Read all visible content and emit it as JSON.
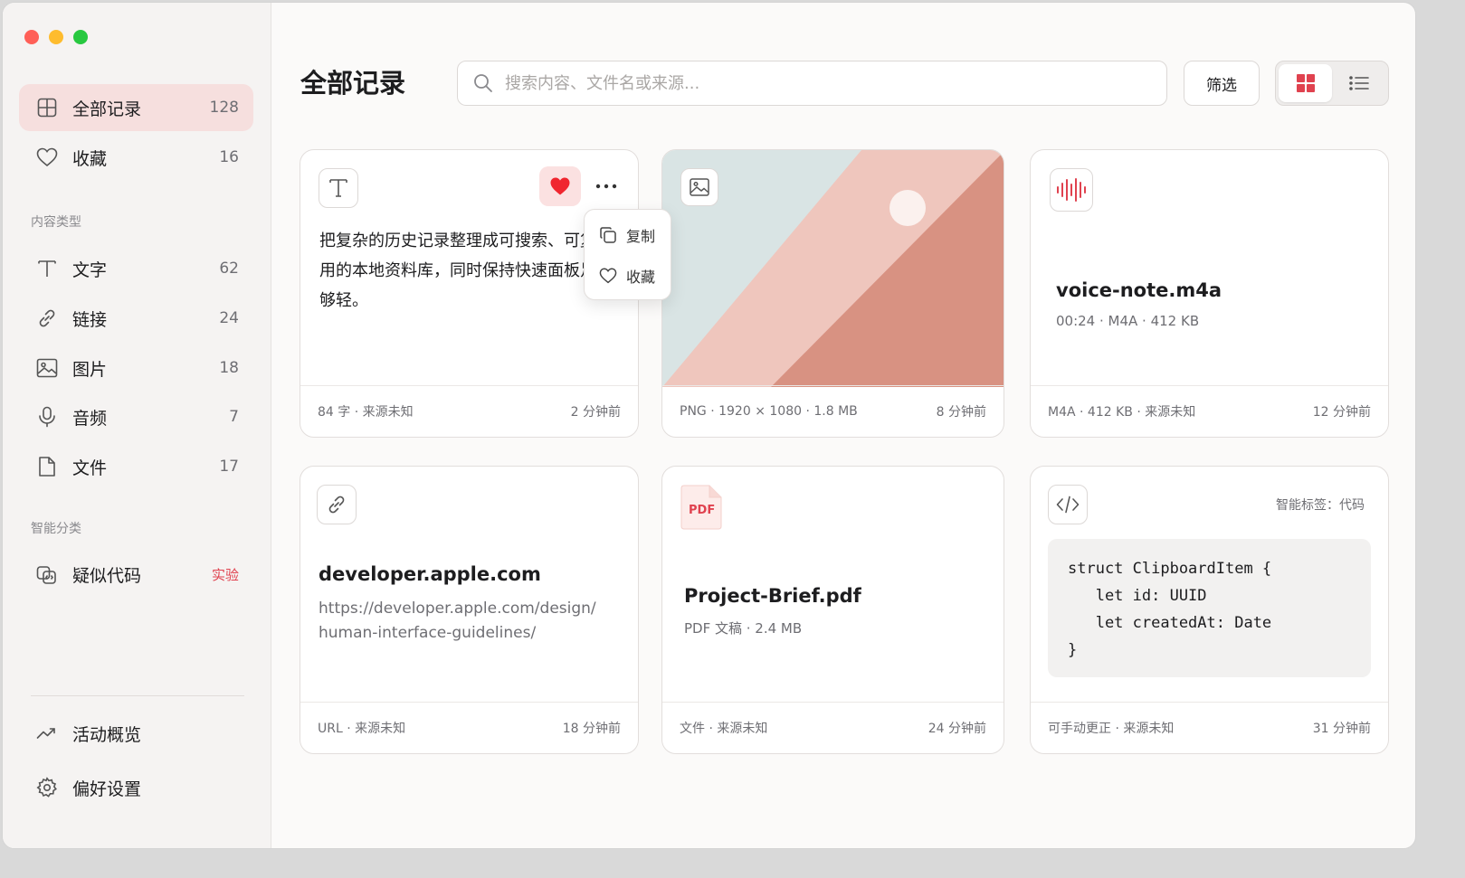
{
  "sidebar": {
    "items": [
      {
        "label": "全部记录",
        "count": "128"
      },
      {
        "label": "收藏",
        "count": "16"
      }
    ],
    "content_types_title": "内容类型",
    "content_types": [
      {
        "label": "文字",
        "count": "62"
      },
      {
        "label": "链接",
        "count": "24"
      },
      {
        "label": "图片",
        "count": "18"
      },
      {
        "label": "音频",
        "count": "7"
      },
      {
        "label": "文件",
        "count": "17"
      }
    ],
    "smart_title": "智能分类",
    "smart": [
      {
        "label": "疑似代码",
        "badge": "实验"
      }
    ],
    "bottom": [
      {
        "label": "活动概览"
      },
      {
        "label": "偏好设置"
      }
    ]
  },
  "header": {
    "title": "全部记录",
    "search_placeholder": "搜索内容、文件名或来源...",
    "filter_label": "筛选"
  },
  "cards": {
    "text": {
      "body": "把复杂的历史记录整理成可搜索、可复用的本地资料库，同时保持快速面板足够轻。",
      "foot_left": "84 字 · 来源未知",
      "foot_right": "2 分钟前"
    },
    "image": {
      "foot_left": "PNG · 1920 × 1080 · 1.8 MB",
      "foot_right": "8 分钟前"
    },
    "audio": {
      "title": "voice-note.m4a",
      "meta": "00:24 · M4A · 412 KB",
      "foot_left": "M4A · 412 KB · 来源未知",
      "foot_right": "12 分钟前"
    },
    "link": {
      "title": "developer.apple.com",
      "url_line1": "https://developer.apple.com/design/",
      "url_line2": "human-interface-guidelines/",
      "foot_left": "URL · 来源未知",
      "foot_right": "18 分钟前"
    },
    "file": {
      "badge": "PDF",
      "title": "Project-Brief.pdf",
      "meta": "PDF 文稿 · 2.4 MB",
      "foot_left": "文件 · 来源未知",
      "foot_right": "24 分钟前"
    },
    "code": {
      "tag": "智能标签：代码",
      "code": "struct ClipboardItem {\n   let id: UUID\n   let createdAt: Date\n}",
      "foot_left": "可手动更正 · 来源未知",
      "foot_right": "31 分钟前"
    }
  },
  "popover": {
    "copy_label": "复制",
    "fav_label": "收藏"
  },
  "colors": {
    "accent": "#e0424f",
    "active_bg": "#f6dfde",
    "heart": "#f0262f"
  }
}
